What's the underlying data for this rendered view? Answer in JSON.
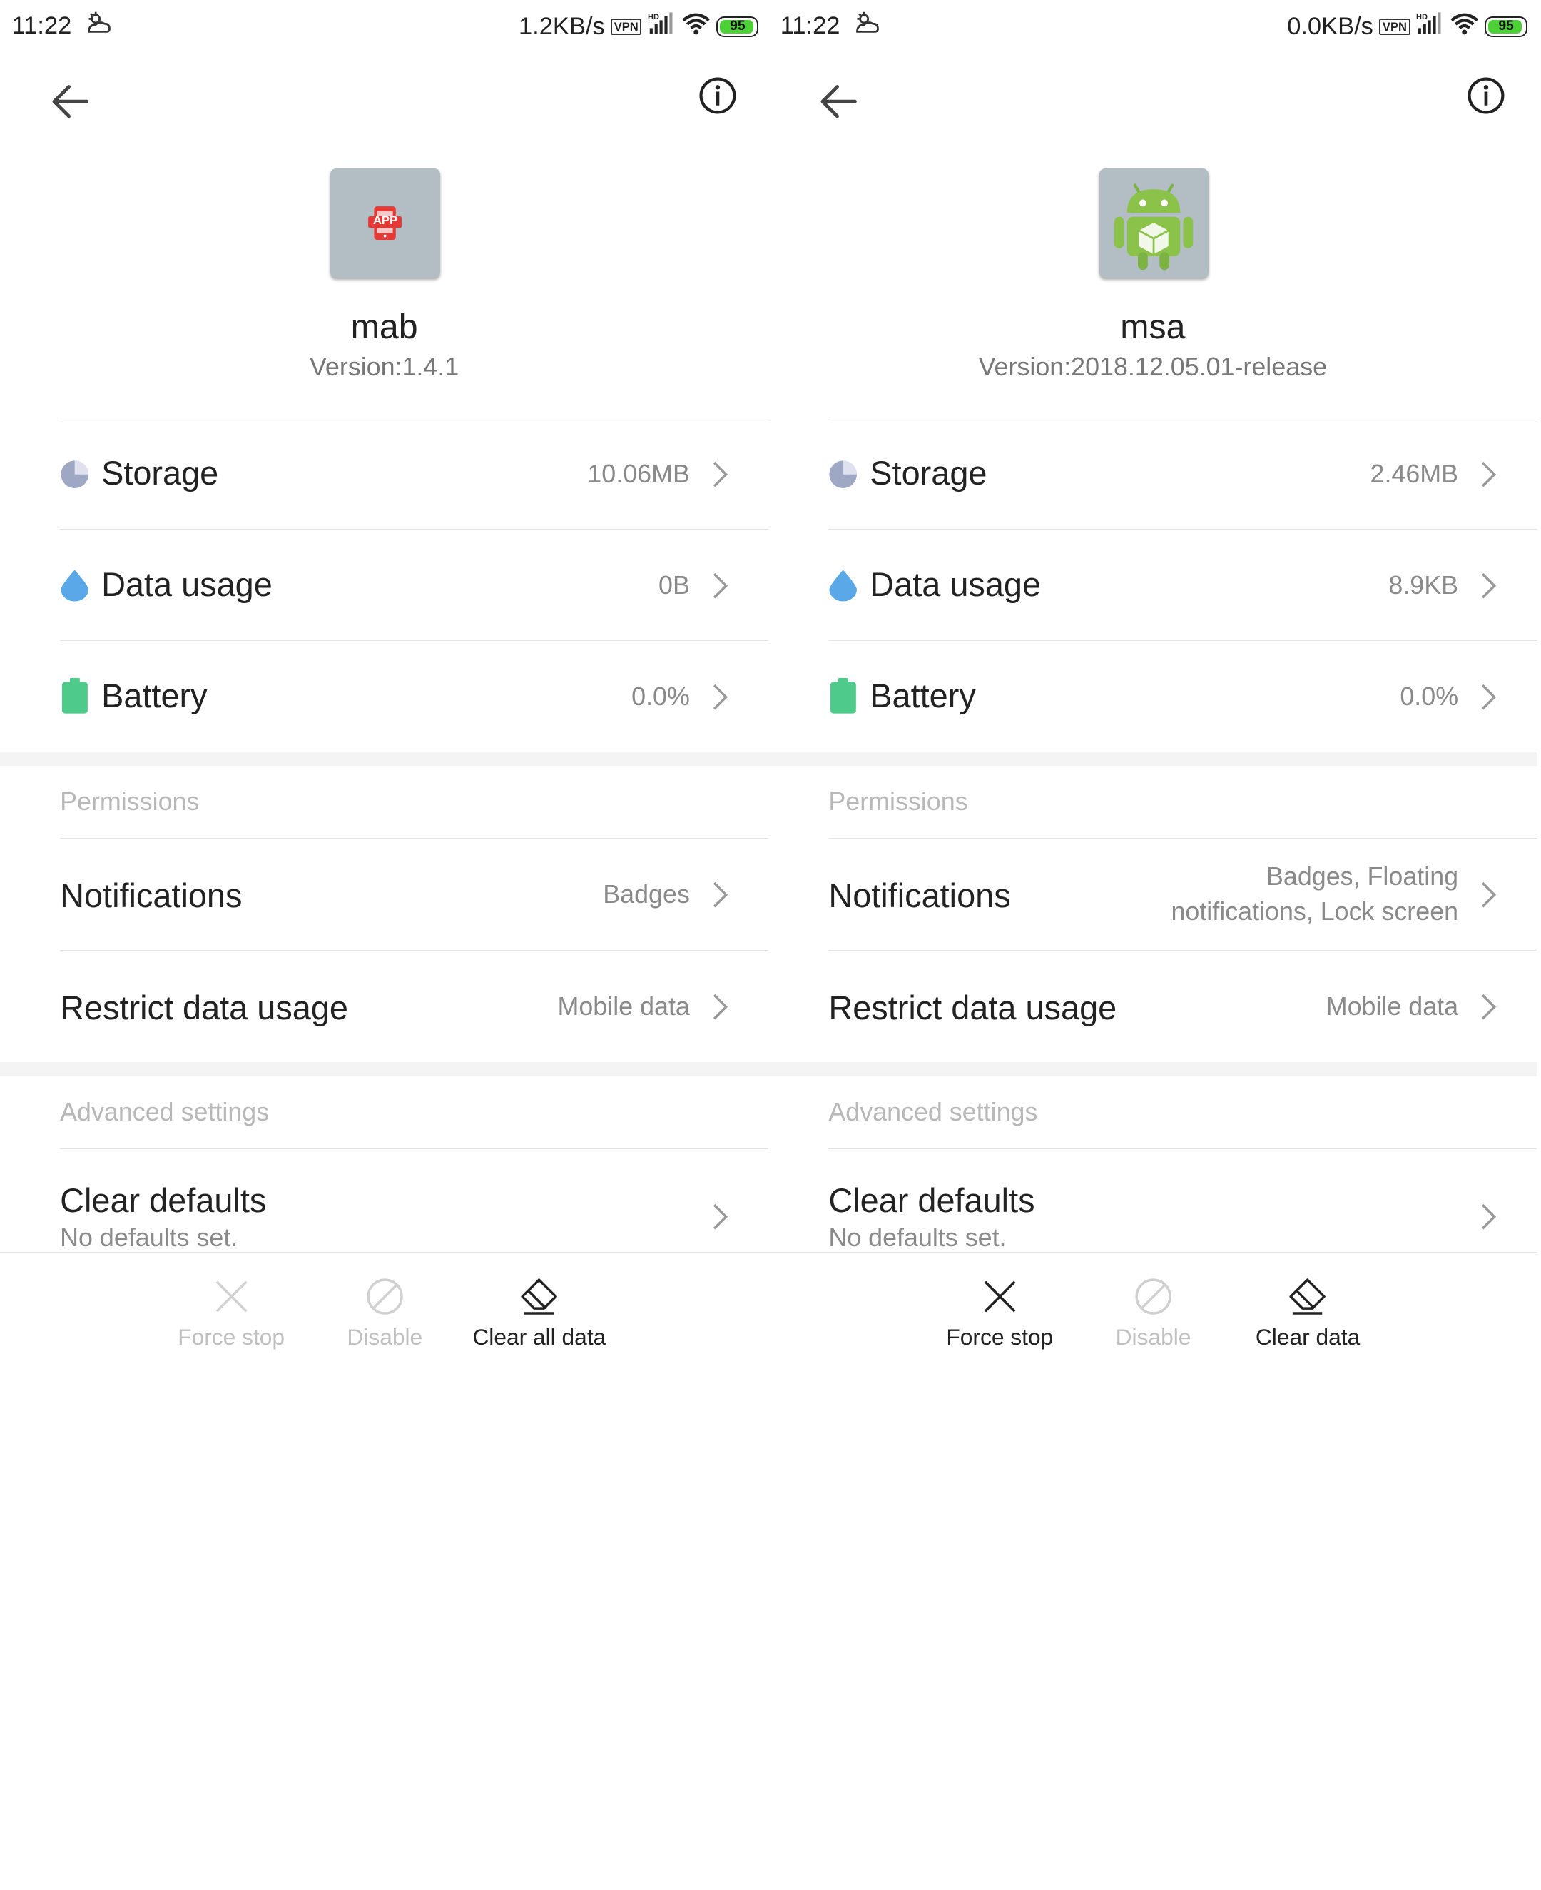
{
  "screens": [
    {
      "status_bar": {
        "time": "11:22",
        "speed": "1.2KB/s",
        "vpn": "VPN",
        "hd": "HD",
        "battery": "95"
      },
      "app": {
        "name": "mab",
        "version": "Version:1.4.1",
        "icon_text": "APP"
      },
      "storage": {
        "label": "Storage",
        "value": "10.06MB"
      },
      "data_usage": {
        "label": "Data usage",
        "value": "0B"
      },
      "battery": {
        "label": "Battery",
        "value": "0.0%"
      },
      "permissions": {
        "title": "Permissions"
      },
      "notifications": {
        "label": "Notifications",
        "value": "Badges",
        "value2": ""
      },
      "restrict": {
        "label": "Restrict data usage",
        "value": "Mobile data"
      },
      "advanced": {
        "title": "Advanced settings"
      },
      "clear_defaults": {
        "label": "Clear defaults",
        "sub": "No defaults set."
      },
      "actions": {
        "force_stop": "Force stop",
        "disable": "Disable",
        "clear": "Clear all data"
      }
    },
    {
      "status_bar": {
        "time": "11:22",
        "speed": "0.0KB/s",
        "vpn": "VPN",
        "hd": "HD",
        "battery": "95"
      },
      "app": {
        "name": "msa",
        "version": "Version:2018.12.05.01-release"
      },
      "storage": {
        "label": "Storage",
        "value": "2.46MB"
      },
      "data_usage": {
        "label": "Data usage",
        "value": "8.9KB"
      },
      "battery": {
        "label": "Battery",
        "value": "0.0%"
      },
      "permissions": {
        "title": "Permissions"
      },
      "notifications": {
        "label": "Notifications",
        "value": "Badges, Floating",
        "value2": "notifications, Lock screen"
      },
      "restrict": {
        "label": "Restrict data usage",
        "value": "Mobile data"
      },
      "advanced": {
        "title": "Advanced settings"
      },
      "clear_defaults": {
        "label": "Clear defaults",
        "sub": "No defaults set."
      },
      "actions": {
        "force_stop": "Force stop",
        "disable": "Disable",
        "clear": "Clear data"
      }
    }
  ],
  "colors": {
    "battery_green": "#4cd137",
    "storage_icon": "#9ea7c4",
    "data_icon": "#5aa8e8",
    "battery_icon": "#4ecb8a",
    "disabled_text": "#c0c0c0",
    "enabled_text": "#222222"
  },
  "icons": {
    "status": [
      "weather-icon",
      "vpn-icon",
      "signal-icon",
      "wifi-icon",
      "battery-icon"
    ],
    "header": [
      "back-arrow-icon",
      "info-icon"
    ],
    "rows": [
      "storage-pie-icon",
      "data-drop-icon",
      "battery-icon",
      "chevron-right-icon"
    ],
    "actions": [
      "close-x-icon",
      "disable-circle-icon",
      "eraser-icon"
    ]
  },
  "action_state": {
    "left": {
      "force_stop_enabled": false,
      "disable_enabled": false,
      "clear_enabled": true
    },
    "right": {
      "force_stop_enabled": true,
      "disable_enabled": false,
      "clear_enabled": true
    }
  }
}
